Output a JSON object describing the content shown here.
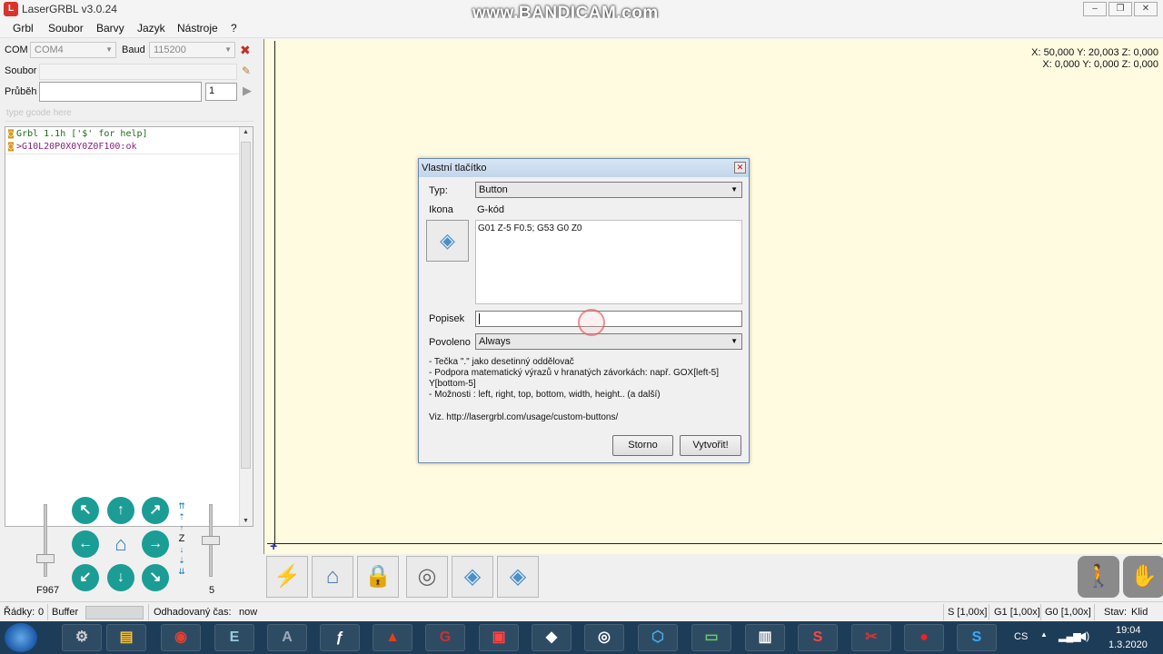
{
  "window": {
    "title": "LaserGRBL v3.0.24",
    "watermark": "www.BANDICAM.com"
  },
  "menu": [
    "Grbl",
    "Soubor",
    "Barvy",
    "Jazyk",
    "Nástroje",
    "?"
  ],
  "connection": {
    "com_label": "COM",
    "com_value": "COM4",
    "baud_label": "Baud",
    "baud_value": "115200"
  },
  "file": {
    "label": "Soubor",
    "value": ""
  },
  "progress": {
    "label": "Průběh",
    "value": "",
    "passes": "1"
  },
  "command": {
    "placeholder": "type gcode here"
  },
  "console": {
    "lines": [
      "Grbl 1.1h ['$' for help]",
      ">G10L20P0X0Y0Z0F100:ok"
    ]
  },
  "jog": {
    "feed_label": "F967",
    "step_label": "5",
    "z_label": "Z"
  },
  "canvas": {
    "coords_line1": "X: 50,000 Y: 20,003 Z: 0,000",
    "coords_line2": "X: 0,000 Y: 0,000 Z: 0,000"
  },
  "dialog": {
    "title": "Vlastní tlačítko",
    "type_label": "Typ:",
    "type_value": "Button",
    "icon_label": "Ikona",
    "gcode_label": "G-kód",
    "gcode_value": "G01 Z-5 F0.5; G53 G0 Z0",
    "caption_label": "Popisek",
    "caption_value": "",
    "enabled_label": "Povoleno",
    "enabled_value": "Always",
    "help_lines": [
      "- Tečka \".\" jako desetinný oddělovač",
      "- Podpora matematický výrazů v hranatých závorkách: např. GOX[left-5]",
      "Y[bottom-5]",
      "- Možnosti : left, right, top, bottom, width, height.. (a další)",
      "Viz. http://lasergrbl.com/usage/custom-buttons/"
    ],
    "cancel_label": "Storno",
    "create_label": "Vytvořit!"
  },
  "status": {
    "lines_label": "Řádky:",
    "lines_value": "0",
    "buffer_label": "Buffer",
    "eta_label": "Odhadovaný čas:",
    "eta_value": "now",
    "s_override": "S [1,00x]",
    "g1_override": "G1 [1,00x]",
    "g0_override": "G0 [1,00x]",
    "state_label": "Stav:",
    "state_value": "Klid"
  },
  "taskbar": {
    "lang": "CS",
    "time": "19:04",
    "date": "1.3.2020",
    "apps": [
      "settings-app",
      "file-explorer",
      "chrome",
      "editor",
      "inkscape",
      "cad-tool",
      "flame-app",
      "grbl",
      "capture",
      "device-app",
      "laser-app",
      "cube-app",
      "monitor-app",
      "printer-app",
      "solidworks",
      "paint-tool",
      "record",
      "skype"
    ]
  },
  "colors": {
    "accent": "#1b9d96",
    "canvas": "#fefbe0",
    "taskbar": "#1d3c57"
  }
}
